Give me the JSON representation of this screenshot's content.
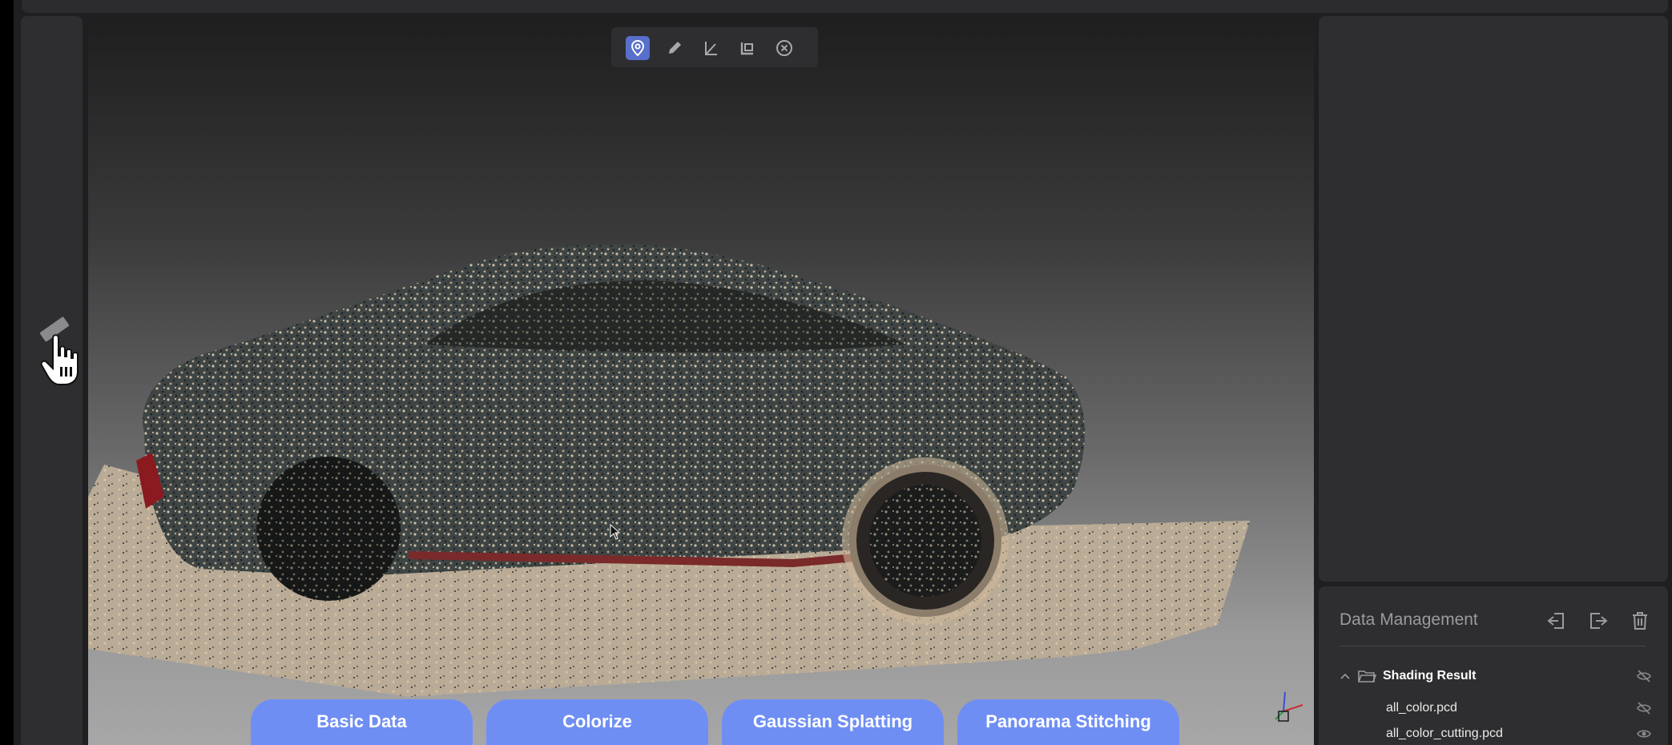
{
  "toolbar": {
    "tools": [
      {
        "name": "point-marker",
        "active": true
      },
      {
        "name": "pencil",
        "active": false
      },
      {
        "name": "angle-measure",
        "active": false
      },
      {
        "name": "area-measure",
        "active": false
      },
      {
        "name": "clear",
        "active": false
      }
    ]
  },
  "bottom_tabs": [
    "Basic Data",
    "Colorize",
    "Gaussian Splatting",
    "Panorama Stitching"
  ],
  "data_management": {
    "title": "Data Management",
    "actions": [
      "import-icon",
      "export-icon",
      "trash-icon"
    ],
    "tree": {
      "folder": {
        "label": "Shading Result",
        "expanded": true,
        "visible": false
      },
      "files": [
        {
          "label": "all_color.pcd",
          "visible": false
        },
        {
          "label": "all_color_cutting.pcd",
          "visible": true
        }
      ]
    }
  },
  "colors": {
    "accent": "#6f8ef4",
    "active_tool": "#5870cc",
    "panel": "#2e2e30"
  }
}
